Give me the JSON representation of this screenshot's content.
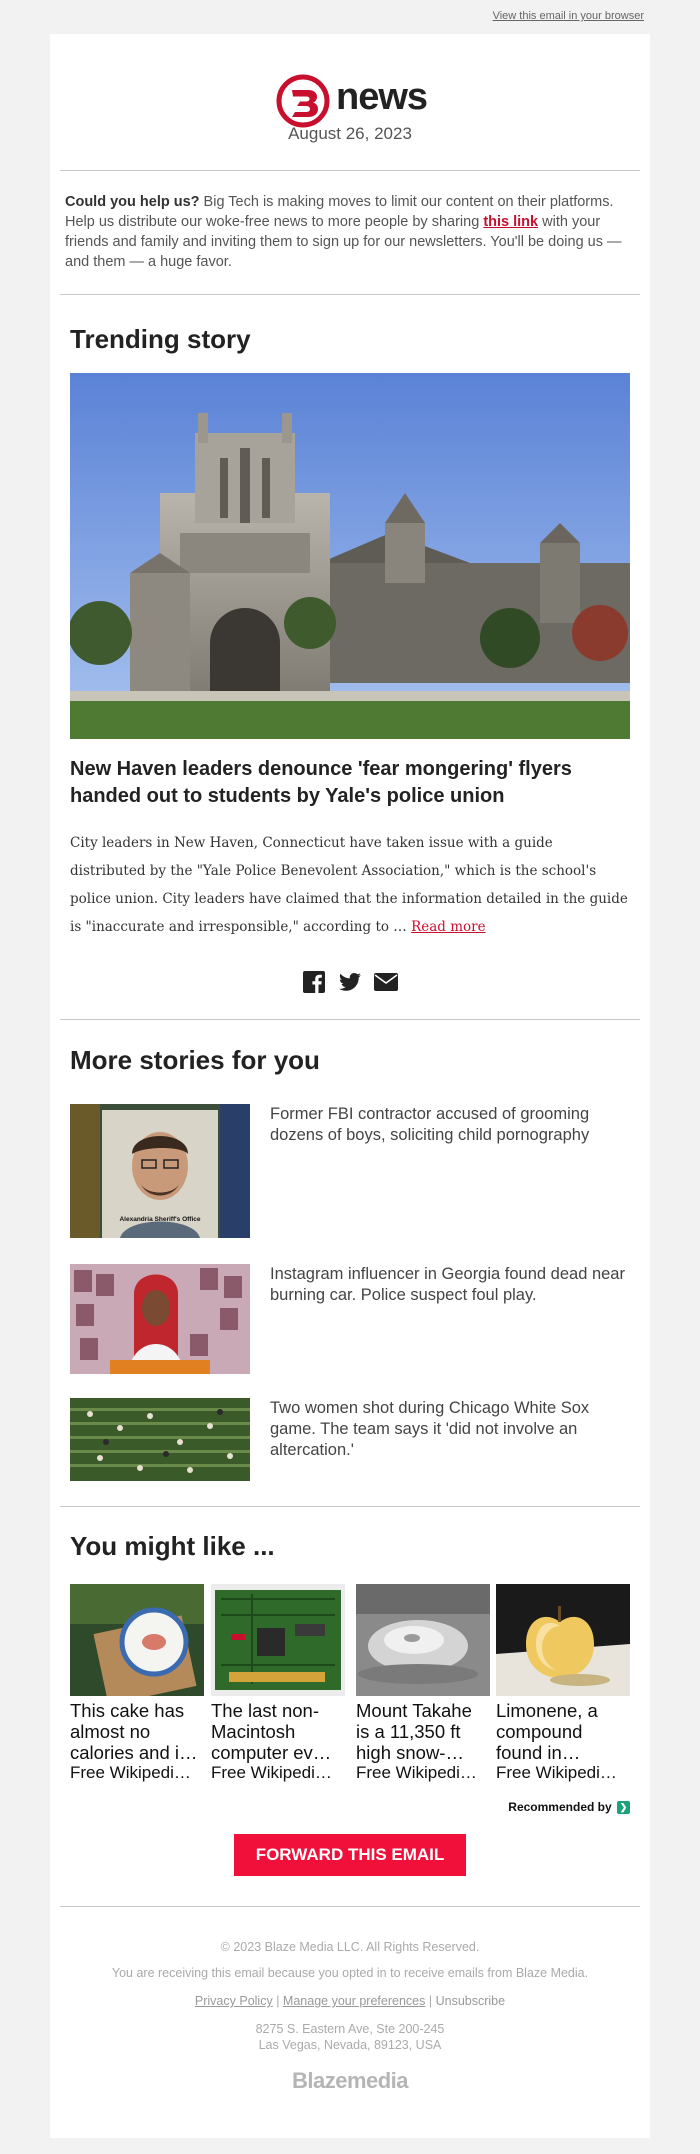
{
  "header": {
    "view_in_browser": "View this email in your browser",
    "logo_text": "news",
    "date": "August 26, 2023"
  },
  "help": {
    "lead": "Could you help us?",
    "text_before": " Big Tech is making moves to limit our content on their platforms. Help us distribute our woke-free news to more people by sharing ",
    "link": "this link",
    "text_after": " with your friends and family and inviting them to sign up for our newsletters. You'll be doing us — and them — a huge favor."
  },
  "trending": {
    "section_title": "Trending story",
    "headline": "New Haven leaders denounce 'fear mongering' flyers handed out to students by Yale's police union",
    "summary": "City leaders in New Haven, Connecticut have taken issue with a guide distributed by the \"Yale Police Benevolent Association,\" which is the school's police union. City leaders have claimed that the information detailed in the guide is \"inaccurate and irresponsible,\" according to … ",
    "read_more": "Read more"
  },
  "share": {
    "icons": [
      "facebook-icon",
      "twitter-icon",
      "email-icon"
    ]
  },
  "more_stories": {
    "section_title": "More stories for you",
    "items": [
      {
        "title": "Former FBI contractor accused of grooming dozens of boys, soliciting child pornography",
        "caption": "Alexandria Sheriff's Office"
      },
      {
        "title": "Instagram influencer in Georgia found dead near burning car. Police suspect foul play."
      },
      {
        "title": "Two women shot during Chicago White Sox game. The team says it 'did not involve an altercation.'"
      }
    ]
  },
  "you_might_like": {
    "section_title": "You might like ...",
    "items": [
      {
        "title": "This cake has almost no calories and i…",
        "source": "Free Wikipedi…"
      },
      {
        "title": "The last non-Macintosh computer ev…",
        "source": "Free Wikipedi…"
      },
      {
        "title": "Mount Takahe is a 11,350 ft high snow-…",
        "source": "Free Wikipedi…"
      },
      {
        "title": "Limonene, a compound found in…",
        "source": "Free Wikipedi…"
      }
    ],
    "recommended_by": "Recommended by"
  },
  "forward_button": "FORWARD THIS EMAIL",
  "footer": {
    "copyright": "© 2023 Blaze Media LLC. All Rights Reserved.",
    "notice": "You are receiving this email because you opted in to receive emails from Blaze Media.",
    "privacy": "Privacy Policy",
    "preferences": "Manage your preferences",
    "unsubscribe": "Unsubscribe",
    "sep": "|",
    "address_1": "8275 S. Eastern Ave, Ste 200-245",
    "address_2": "Las Vegas, Nevada, 89123, USA",
    "logo_text": "Blazemedia"
  },
  "colors": {
    "brand_red": "#c8102e",
    "button_red": "#f0103a",
    "outbrain_green": "#1aa37a"
  }
}
